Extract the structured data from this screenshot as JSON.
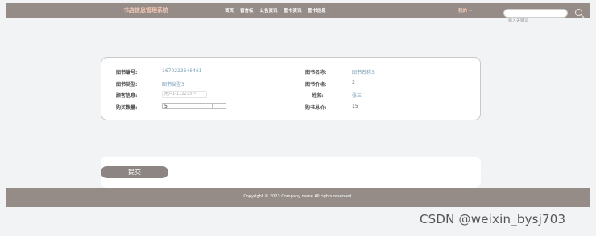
{
  "header": {
    "brand": "书店信息管理系统",
    "nav": [
      "首页",
      "留言板",
      "公告资讯",
      "图书资讯",
      "图书信息"
    ],
    "user_menu": "我的 ~",
    "search_placeholder": "输入关键词",
    "background": "#958b87"
  },
  "form": {
    "book_no_label": "图书编号:",
    "book_no": "1670223646461",
    "book_name_label": "图书名称:",
    "book_name": "图书名称3",
    "book_type_label": "图书类型:",
    "book_type": "图书类型3",
    "book_price_label": "图书价格:",
    "book_price": "3",
    "customer_label": "顾客信息:",
    "customer_select": "用户1-112233 ~",
    "name_label": "姓名:",
    "name": "张三",
    "quantity_label": "购买数量:",
    "quantity": "5",
    "total_label": "购书总价:",
    "total": "15"
  },
  "actions": {
    "submit_label": "提交"
  },
  "footer": {
    "copyright": "Copyright © 2023.Company name All rights reserved."
  },
  "watermark": "CSDN @weixin_bysj703"
}
